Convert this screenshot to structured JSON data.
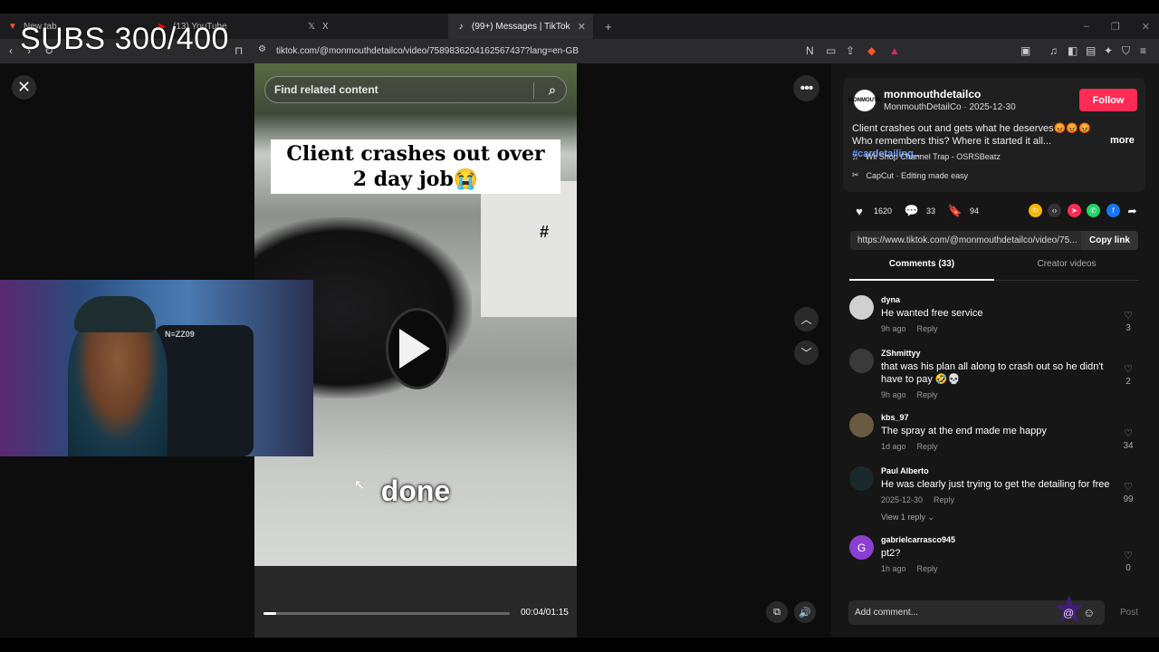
{
  "overlay": {
    "subs": "SUBS 300/400"
  },
  "browser": {
    "tabs": [
      {
        "label": "New tab",
        "favicon": "brave-icon"
      },
      {
        "label": "(13) YouTube",
        "favicon": "youtube-icon"
      },
      {
        "label": "X",
        "favicon": "x-icon"
      },
      {
        "label": "(99+) Messages | TikTok",
        "favicon": "tiktok-icon"
      }
    ],
    "new_tab": "+",
    "url": "tiktok.com/@monmouthdetailco/video/7589836204162567437?lang=en-GB",
    "window_controls": [
      "–",
      "❐",
      "✕"
    ]
  },
  "video": {
    "search_placeholder": "Find related content",
    "caption": "Client crashes out over 2 day job😭",
    "overlay_word": "done",
    "hash_mark": "#",
    "time": "00:04/01:15",
    "progress": 0.05
  },
  "webcam": {
    "chair_logo": "N≡ZZ09"
  },
  "post": {
    "username": "monmouthdetailco",
    "subline": "MonmouthDetailCo · 2025-12-30",
    "follow_label": "Follow",
    "description": "Client crashes out and gets what he deserves😡😡😡 Who remembers this? Where it started it all...",
    "hashtag": "#cardetailing...",
    "more_label": "more",
    "music": "Wii Shop Channel Trap - OSRSBeatz",
    "capcut": "CapCut · Editing made easy",
    "likes": "1620",
    "comments": "33",
    "saves": "94",
    "link": "https://www.tiktok.com/@monmouthdetailco/video/75...",
    "copy_link_label": "Copy link",
    "avatar_text": "MONMOUTH"
  },
  "tabs": {
    "comments": "Comments (33)",
    "creator": "Creator videos"
  },
  "comments": [
    {
      "name": "dyna",
      "text": "He wanted free service",
      "time": "9h ago",
      "reply": "Reply",
      "likes": "3"
    },
    {
      "name": "ZShmittyy",
      "text": "that was his plan all along to crash out so he didn't have to pay 🤣💀",
      "time": "9h ago",
      "reply": "Reply",
      "likes": "2"
    },
    {
      "name": "kbs_97",
      "text": "The spray at the end made me happy",
      "time": "1d ago",
      "reply": "Reply",
      "likes": "34"
    },
    {
      "name": "Paul Alberto",
      "text": "He was clearly just trying to get the detailing for free",
      "time": "2025-12-30",
      "reply": "Reply",
      "likes": "99",
      "view_replies": "View 1 reply ⌄"
    },
    {
      "name": "gabrielcarrasco945",
      "text": "pt2?",
      "time": "1h ago",
      "reply": "Reply",
      "likes": "0",
      "avatar_letter": "G"
    }
  ],
  "composer": {
    "placeholder": "Add comment...",
    "at": "@",
    "post_label": "Post"
  },
  "colors": {
    "follow": "#fe2c55",
    "hashtag": "#6b9bff",
    "avatar_g": "#8b3fd1"
  }
}
